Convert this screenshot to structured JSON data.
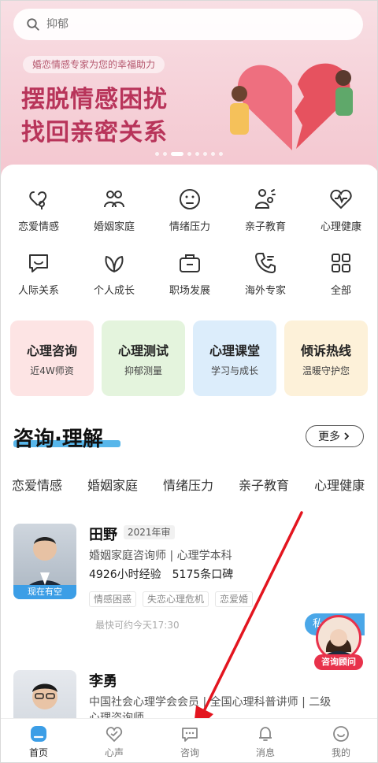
{
  "search": {
    "placeholder": "抑郁"
  },
  "banner": {
    "tagline": "婚恋情感专家为您的幸福助力",
    "title_line1": "摆脱情感困扰",
    "title_line2": "找回亲密关系"
  },
  "categories": [
    {
      "label": "恋爱情感",
      "icon": "love-icon"
    },
    {
      "label": "婚姻家庭",
      "icon": "family-icon"
    },
    {
      "label": "情绪压力",
      "icon": "mood-icon"
    },
    {
      "label": "亲子教育",
      "icon": "parent-child-icon"
    },
    {
      "label": "心理健康",
      "icon": "heart-pulse-icon"
    },
    {
      "label": "人际关系",
      "icon": "chat-icon"
    },
    {
      "label": "个人成长",
      "icon": "leaf-icon"
    },
    {
      "label": "职场发展",
      "icon": "briefcase-icon"
    },
    {
      "label": "海外专家",
      "icon": "phone-icon"
    },
    {
      "label": "全部",
      "icon": "grid-icon"
    }
  ],
  "feature_cards": [
    {
      "title": "心理咨询",
      "subtitle": "近4W师资"
    },
    {
      "title": "心理测试",
      "subtitle": "抑郁测量"
    },
    {
      "title": "心理课堂",
      "subtitle": "学习与成长"
    },
    {
      "title": "倾诉热线",
      "subtitle": "温暖守护您"
    }
  ],
  "section": {
    "title": "咨询·理解",
    "more_label": "更多"
  },
  "topic_tabs": [
    "恋爱情感",
    "婚姻家庭",
    "情绪压力",
    "亲子教育",
    "心理健康"
  ],
  "counselors": [
    {
      "name": "田野",
      "year_badge": "2021年审",
      "title": "婚姻家庭咨询师 | 心理学本科",
      "hours": "4926小时经验",
      "reviews": "5175条口碑",
      "tags": [
        "情感困惑",
        "失恋心理危机",
        "恋爱婚"
      ],
      "availability": "现在有空",
      "next_time": "最快可约今天17:30",
      "consult_label": "私"
    },
    {
      "name": "李勇",
      "title": "中国社会心理学会会员 | 全国心理科普讲师 | 二级",
      "title_line2": "心理咨询师"
    }
  ],
  "advisor": {
    "label": "咨询顾问"
  },
  "tabbar": [
    {
      "label": "首页",
      "icon": "home-icon",
      "active": true
    },
    {
      "label": "心声",
      "icon": "heart-voice-icon",
      "active": false
    },
    {
      "label": "咨询",
      "icon": "consult-chat-icon",
      "active": false
    },
    {
      "label": "消息",
      "icon": "bell-icon",
      "active": false
    },
    {
      "label": "我的",
      "icon": "smile-face-icon",
      "active": false
    }
  ],
  "colors": {
    "accent": "#3aa9e6",
    "brand_red": "#e8324b",
    "banner_title": "#b8345a"
  }
}
